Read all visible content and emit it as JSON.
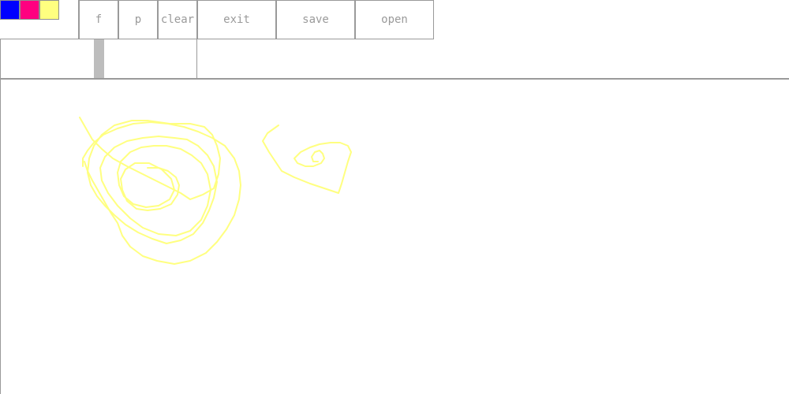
{
  "palette": {
    "colors": [
      "#0000ff",
      "#ff0080",
      "#ffff80"
    ]
  },
  "toolbar": {
    "f_label": "f",
    "p_label": "p",
    "clear_label": "clear",
    "exit_label": "exit",
    "save_label": "save",
    "open_label": "open"
  },
  "brush": {
    "stroke_color": "#ffff80",
    "size_level": 0.5
  }
}
